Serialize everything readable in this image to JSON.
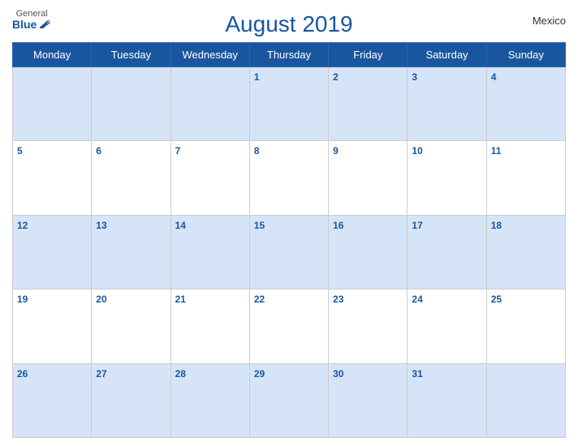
{
  "header": {
    "logo_general": "General",
    "logo_blue": "Blue",
    "title": "August 2019",
    "country": "Mexico"
  },
  "weekdays": [
    "Monday",
    "Tuesday",
    "Wednesday",
    "Thursday",
    "Friday",
    "Saturday",
    "Sunday"
  ],
  "weeks": [
    [
      null,
      null,
      null,
      1,
      2,
      3,
      4
    ],
    [
      5,
      6,
      7,
      8,
      9,
      10,
      11
    ],
    [
      12,
      13,
      14,
      15,
      16,
      17,
      18
    ],
    [
      19,
      20,
      21,
      22,
      23,
      24,
      25
    ],
    [
      26,
      27,
      28,
      29,
      30,
      31,
      null
    ]
  ]
}
